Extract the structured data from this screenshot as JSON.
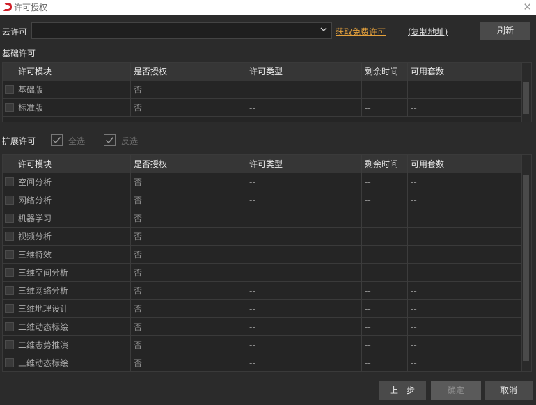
{
  "window": {
    "title": "许可授权",
    "close_glyph": "✕"
  },
  "cloud": {
    "label": "云许可",
    "selected": "",
    "free_link": "获取免费许可",
    "copy_link": "(复制地址)",
    "refresh": "刷新"
  },
  "basic": {
    "label": "基础许可",
    "columns": [
      "许可模块",
      "是否授权",
      "许可类型",
      "剩余时间",
      "可用套数"
    ],
    "rows": [
      [
        "基础版",
        "否",
        "--",
        "--",
        "--"
      ],
      [
        "标准版",
        "否",
        "--",
        "--",
        "--"
      ]
    ]
  },
  "extended": {
    "label": "扩展许可",
    "select_all": "全选",
    "invert": "反选",
    "columns": [
      "许可模块",
      "是否授权",
      "许可类型",
      "剩余时间",
      "可用套数"
    ],
    "rows": [
      [
        "空间分析",
        "否",
        "--",
        "--",
        "--"
      ],
      [
        "网络分析",
        "否",
        "--",
        "--",
        "--"
      ],
      [
        "机器学习",
        "否",
        "--",
        "--",
        "--"
      ],
      [
        "视频分析",
        "否",
        "--",
        "--",
        "--"
      ],
      [
        "三维特效",
        "否",
        "--",
        "--",
        "--"
      ],
      [
        "三维空间分析",
        "否",
        "--",
        "--",
        "--"
      ],
      [
        "三维网络分析",
        "否",
        "--",
        "--",
        "--"
      ],
      [
        "三维地理设计",
        "否",
        "--",
        "--",
        "--"
      ],
      [
        "二维动态标绘",
        "否",
        "--",
        "--",
        "--"
      ],
      [
        "二维态势推演",
        "否",
        "--",
        "--",
        "--"
      ],
      [
        "三维动态标绘",
        "否",
        "--",
        "--",
        "--"
      ]
    ]
  },
  "footer": {
    "prev": "上一步",
    "ok": "确定",
    "cancel": "取消"
  },
  "colors": {
    "accent_link": "#e6a23c",
    "logo": "#d0202a"
  }
}
